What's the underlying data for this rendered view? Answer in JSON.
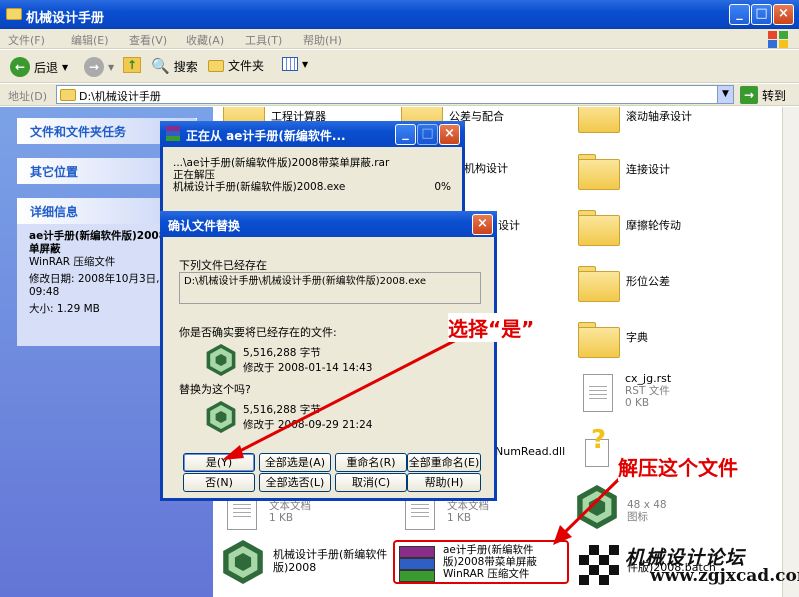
{
  "window": {
    "title": "机械设计手册"
  },
  "menu": [
    "文件(F)",
    "编辑(E)",
    "查看(V)",
    "收藏(A)",
    "工具(T)",
    "帮助(H)"
  ],
  "toolbar": {
    "back": "后退",
    "search": "搜索",
    "folders": "文件夹"
  },
  "address": {
    "label": "地址(D)",
    "path": "D:\\机械设计手册",
    "go": "转到"
  },
  "sidebar": {
    "tasks": "文件和文件夹任务",
    "other": "其它位置",
    "details": {
      "head": "详细信息",
      "name": "ae计手册(新编软件版)2008带菜单屏蔽",
      "type": "WinRAR 压缩文件",
      "modified": "修改日期: 2008年10月3日, 09:48",
      "size": "大小: 1.29 MB"
    }
  },
  "files": {
    "f1": "工程计算器",
    "f2": "公差与配合",
    "f3": "滚动轴承设计",
    "f4": "杆机构设计",
    "f5": "连接设计",
    "f6": "设计",
    "f7": "摩擦轮传动",
    "f8": "形位公差",
    "f9": "字典",
    "rst_name": "cx_jg.rst",
    "rst_type": "RST 文件",
    "rst_size": "0 KB",
    "dll": "NumRead.dll",
    "txt1_type": "文本文档",
    "txt1_size": "1 KB",
    "txt2_type": "文本文档",
    "txt2_size": "1 KB",
    "ico_dim": "48 x 48",
    "ico_type": "图标",
    "exe_name": "机械设计手册(新编软件版)2008",
    "rar_name": "ae计手册(新编软件版)2008带菜单屏蔽",
    "rar_type": "WinRAR 压缩文件",
    "bat": "件版)2008.batch"
  },
  "extract": {
    "title": "正在从 ae计手册(新编软件...",
    "line1": "...\\ae计手册(新编软件版)2008带菜单屏蔽.rar",
    "line2": "正在解压",
    "line3": "机械设计手册(新编软件版)2008.exe",
    "pct": "0%"
  },
  "confirm": {
    "title": "确认文件替换",
    "exists": "下列文件已经存在",
    "path": "D:\\机械设计手册\\机械设计手册(新编软件版)2008.exe",
    "question": "你是否确实要将已经存在的文件:",
    "old_size": "5,516,288 字节",
    "old_date": "修改于 2008-01-14 14:43",
    "replace": "替换为这个吗?",
    "new_size": "5,516,288 字节",
    "new_date": "修改于 2008-09-29 21:24",
    "buttons": {
      "yes": "是(Y)",
      "yes_all": "全部选是(A)",
      "rename": "重命名(R)",
      "rename_all": "全部重命名(E)",
      "no": "否(N)",
      "no_all": "全部选否(L)",
      "cancel": "取消(C)",
      "help": "帮助(H)"
    }
  },
  "annotations": {
    "choose_yes": "选择“是”",
    "extract_file": "解压这个文件"
  },
  "watermark": {
    "title": "机械设计论坛",
    "url": "www.zgjxcad.com"
  }
}
